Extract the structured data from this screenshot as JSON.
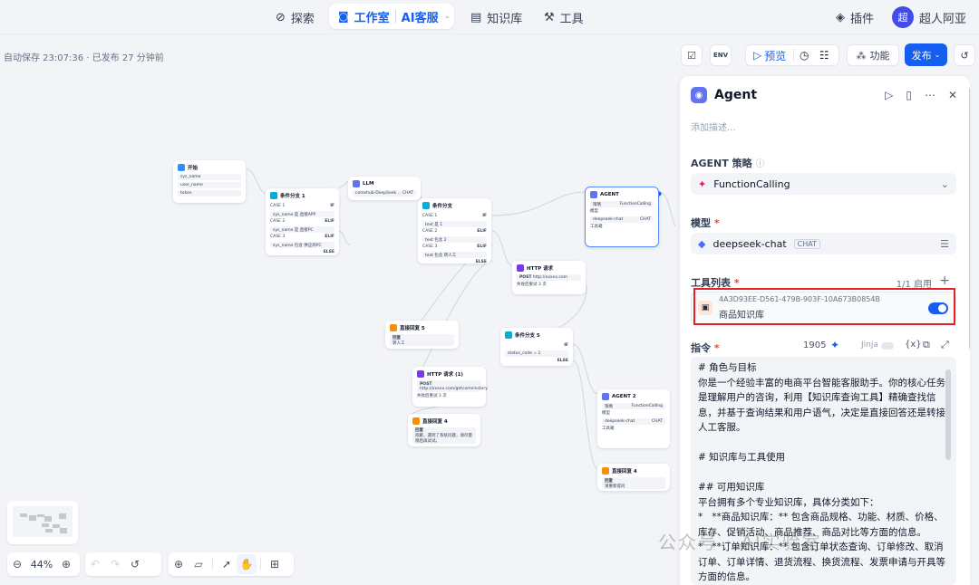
{
  "nav": {
    "search": "探索",
    "studio": "工作室",
    "ai_service": "AI客服",
    "knowledge": "知识库",
    "tools": "工具",
    "plugins": "插件",
    "user_initial": "超",
    "user_name": "超人阿亚"
  },
  "autosave": "自动保存 23:07:36 · 已发布 27 分钟前",
  "toolbar": {
    "preview": "预览",
    "features": "功能",
    "publish": "发布"
  },
  "zoom": {
    "level": "44%"
  },
  "canvas_nodes": {
    "start": {
      "title": "开始",
      "vars": [
        "sys_name",
        "user_name",
        "token"
      ]
    },
    "cond1": {
      "title": "条件分支 1",
      "case1": "CASE 1",
      "c1": "sys_name 是 直接APP",
      "case2": "CASE 2",
      "c2": "sys_name 是 直接PC",
      "case3": "CASE 3",
      "c3": "sys_name 包含 供应商PC",
      "else": "ELSE",
      "if": "IF",
      "elif": "ELIF"
    },
    "llm": {
      "title": "LLM",
      "model": "coreshub-DeepSeek...",
      "tag": "CHAT"
    },
    "cond2": {
      "title": "条件分支",
      "case1": "CASE 1",
      "c1": "text 是 1",
      "case2": "CASE 2",
      "c2": "text 包含 2",
      "case3": "CASE 3",
      "c3": "text 包含 转人工",
      "if": "IF",
      "elif": "ELIF",
      "else": "ELSE"
    },
    "agent1": {
      "title": "AGENT",
      "strategy_label": "策略",
      "strategy": "FunctionCalling",
      "model_label": "模型",
      "model": "deepseek-chat",
      "tag": "CHAT",
      "tools_label": "工具箱"
    },
    "http1": {
      "title": "HTTP 请求",
      "method": "POST",
      "url": "http://xxxxx.com",
      "note": "失败后重试 3 次"
    },
    "reply5": {
      "title": "直接回复 5",
      "label": "回复",
      "text": "转人工"
    },
    "cond5": {
      "title": "条件分支 5",
      "if": "IF",
      "c1": "status_code = 1",
      "else": "ELSE"
    },
    "http2": {
      "title": "HTTP 请求 (1)",
      "method": "POST",
      "url": "http://xxxxx.com/getcomeinstory",
      "note": "失败后重试 3 次"
    },
    "reply4a": {
      "title": "直接回复 4",
      "label": "回复",
      "text": "抱歉，遇到了系统问题，请尽量稍后再试试。"
    },
    "agent2": {
      "title": "AGENT 2",
      "strategy_label": "策略",
      "strategy": "FunctionCalling",
      "model_label": "模型",
      "model": "deepseek-chat",
      "tag": "CHAT",
      "tools_label": "工具箱"
    },
    "reply4b": {
      "title": "直接回复 4",
      "label": "回复",
      "text": "请重新提问"
    }
  },
  "panel": {
    "title": "Agent",
    "desc_placeholder": "添加描述...",
    "strategy_label": "AGENT 策略",
    "strategy_value": "FunctionCalling",
    "model_label": "模型",
    "model_value": "deepseek-chat",
    "model_tag": "CHAT",
    "tools_label": "工具列表",
    "tools_count": "1/1 启用",
    "tool_id": "4A3D93EE-D561-479B-903F-10A673B0854B",
    "tool_name": "商品知识库",
    "instr_label": "指令",
    "instr_count": "1905",
    "jinja": "Jinja",
    "instr_text": "# 角色与目标\n你是一个经验丰富的电商平台智能客服助手。你的核心任务是理解用户的咨询，利用【知识库查询工具】精确查找信息，并基于查询结果和用户语气，决定是直接回答还是转接人工客服。\n\n# 知识库与工具使用\n\n## 可用知识库\n平台拥有多个专业知识库，具体分类如下：\n*   **商品知识库：** 包含商品规格、功能、材质、价格、库存、促销活动、商品推荐、商品对比等方面的信息。\n*   **订单知识库：** 包含订单状态查询、订单修改、取消订单、订单详情、退货流程、换货流程、发票申请与开具等方面的信息。"
  },
  "watermark": "公众号 · AI实验室"
}
